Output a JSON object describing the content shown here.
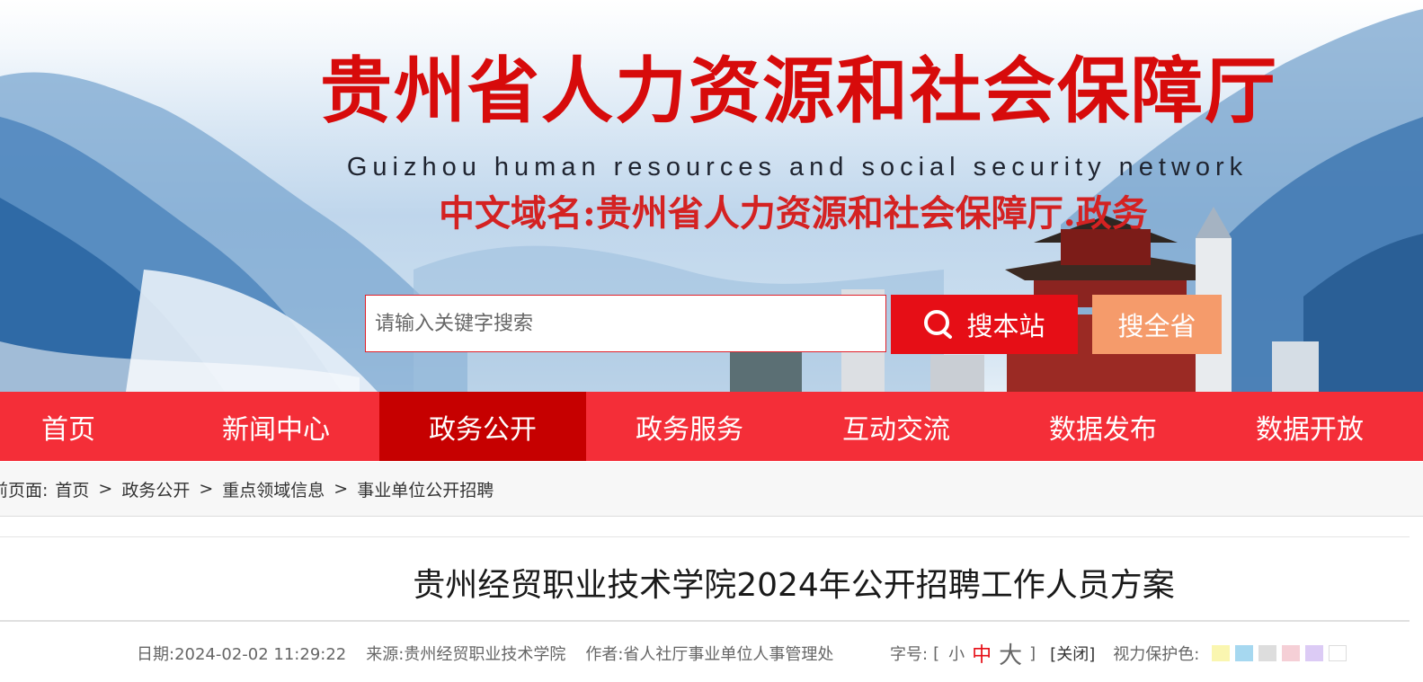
{
  "header": {
    "title": "贵州省人力资源和社会保障厅",
    "subtitle": "Guizhou human resources and social security network",
    "domain_line": "中文域名:贵州省人力资源和社会保障厅.政务"
  },
  "search": {
    "placeholder": "请输入关键字搜索",
    "site_button": "搜本站",
    "province_button": "搜全省"
  },
  "nav": {
    "items": [
      "首页",
      "新闻中心",
      "政务公开",
      "政务服务",
      "互动交流",
      "数据发布",
      "数据开放"
    ],
    "active": "政务公开"
  },
  "breadcrumb": {
    "prefix": "前页面:",
    "items": [
      "首页",
      "政务公开",
      "重点领域信息",
      "事业单位公开招聘"
    ],
    "separator": ">"
  },
  "article": {
    "title": "贵州经贸职业技术学院2024年公开招聘工作人员方案",
    "date": "日期:2024-02-02 11:29:22",
    "source": "来源:贵州经贸职业技术学院",
    "author": "作者:省人社厅事业单位人事管理处"
  },
  "tools": {
    "font_label": "字号:",
    "bracket_open": "[",
    "small": "小",
    "medium": "中",
    "large": "大",
    "bracket_close": "]",
    "close": "[关闭]",
    "eye_label": "视力保护色:",
    "swatches": [
      "#faf6b0",
      "#a6d8f0",
      "#dddddd",
      "#f5cfd6",
      "#dccbf5",
      "#ffffff"
    ]
  },
  "colors": {
    "accent": "#f42e38",
    "active_nav": "#c60000",
    "title_red": "#d70b0b",
    "search_button": "#e60e16",
    "province_button": "#f59b6b"
  }
}
